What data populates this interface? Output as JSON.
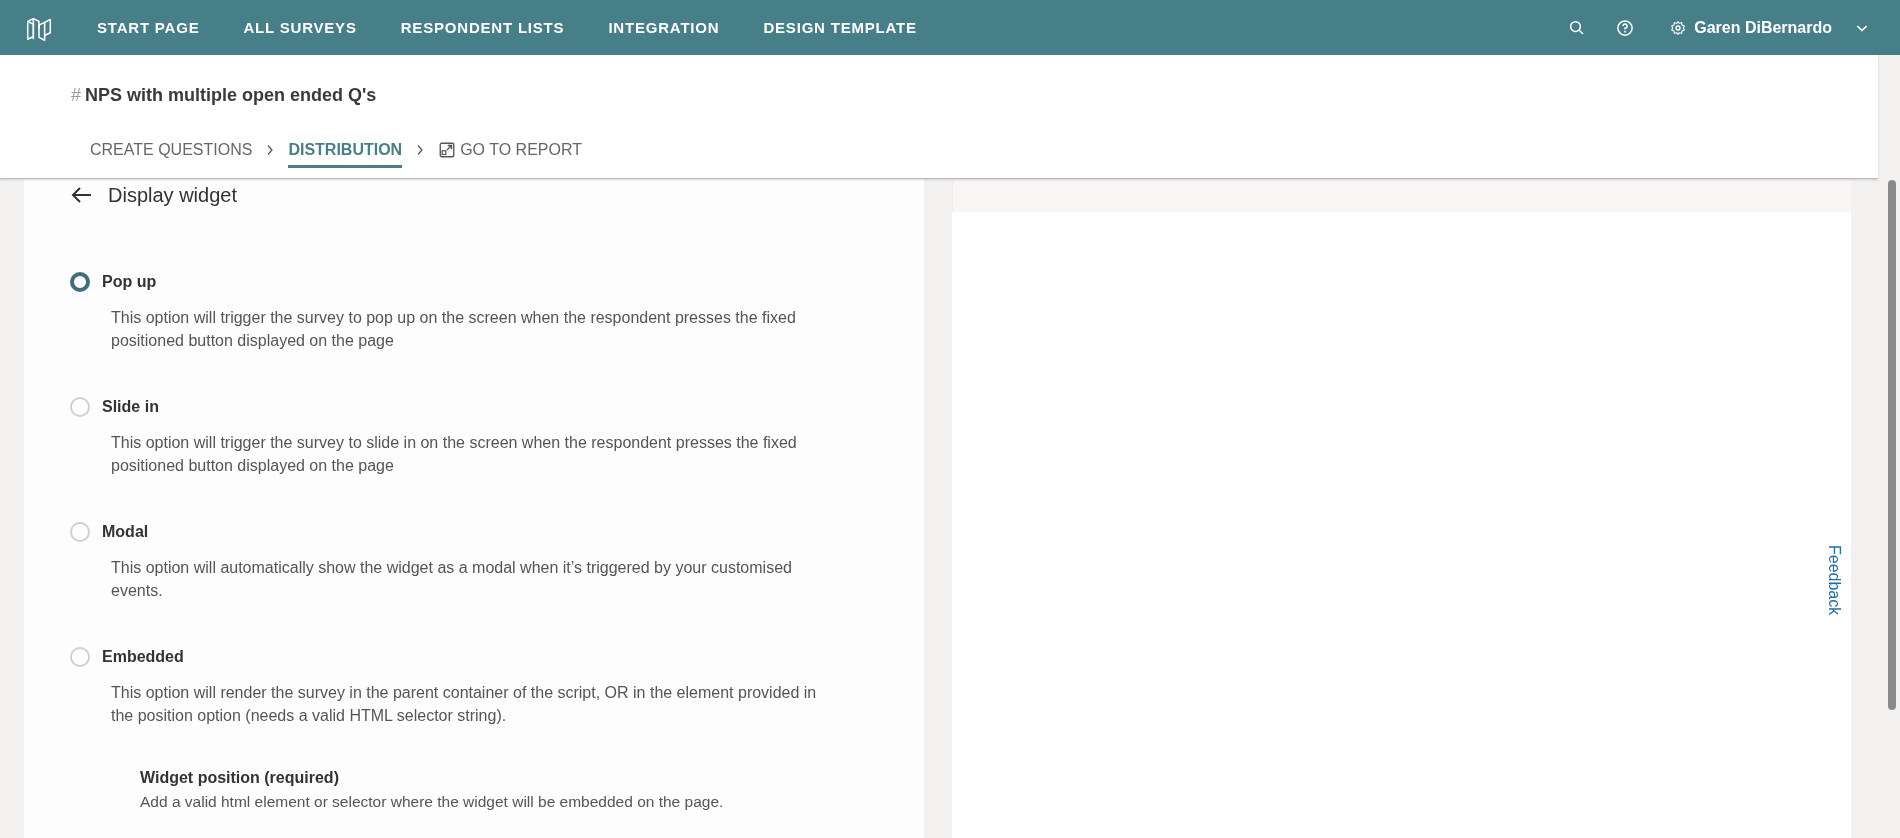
{
  "top_nav": {
    "items": [
      {
        "label": "START PAGE"
      },
      {
        "label": "ALL SURVEYS"
      },
      {
        "label": "RESPONDENT LISTS"
      },
      {
        "label": "INTEGRATION"
      },
      {
        "label": "DESIGN TEMPLATE"
      }
    ],
    "user": {
      "name": "Garen DiBernardo"
    }
  },
  "survey": {
    "hash": "#",
    "title": "NPS with multiple open ended Q's"
  },
  "steps": [
    {
      "label": "CREATE QUESTIONS",
      "kind": "step",
      "selected": false
    },
    {
      "label": "DISTRIBUTION",
      "kind": "step",
      "selected": true
    },
    {
      "label": "GO TO REPORT",
      "kind": "link",
      "selected": false
    }
  ],
  "widget_panel": {
    "title": "Display widget",
    "options": [
      {
        "label": "Pop up",
        "description": "This option will trigger the survey to pop up on the screen when the respondent presses the fixed positioned button displayed on the page",
        "selected": true
      },
      {
        "label": "Slide in",
        "description": "This option will trigger the survey to slide in on the screen when the respondent presses the fixed positioned button displayed on the page",
        "selected": false
      },
      {
        "label": "Modal",
        "description": "This option will automatically show the widget as a modal when it’s triggered by your customised events.",
        "selected": false
      },
      {
        "label": "Embedded",
        "description": "This option will render the survey in the parent container of the script, OR in the element provided in the position option (needs a valid HTML selector string).",
        "selected": false
      }
    ],
    "position_field": {
      "label": "Widget position (required)",
      "help": "Add a valid html element or selector where the widget will be embedded on the page."
    }
  },
  "feedback_tab": "Feedback"
}
